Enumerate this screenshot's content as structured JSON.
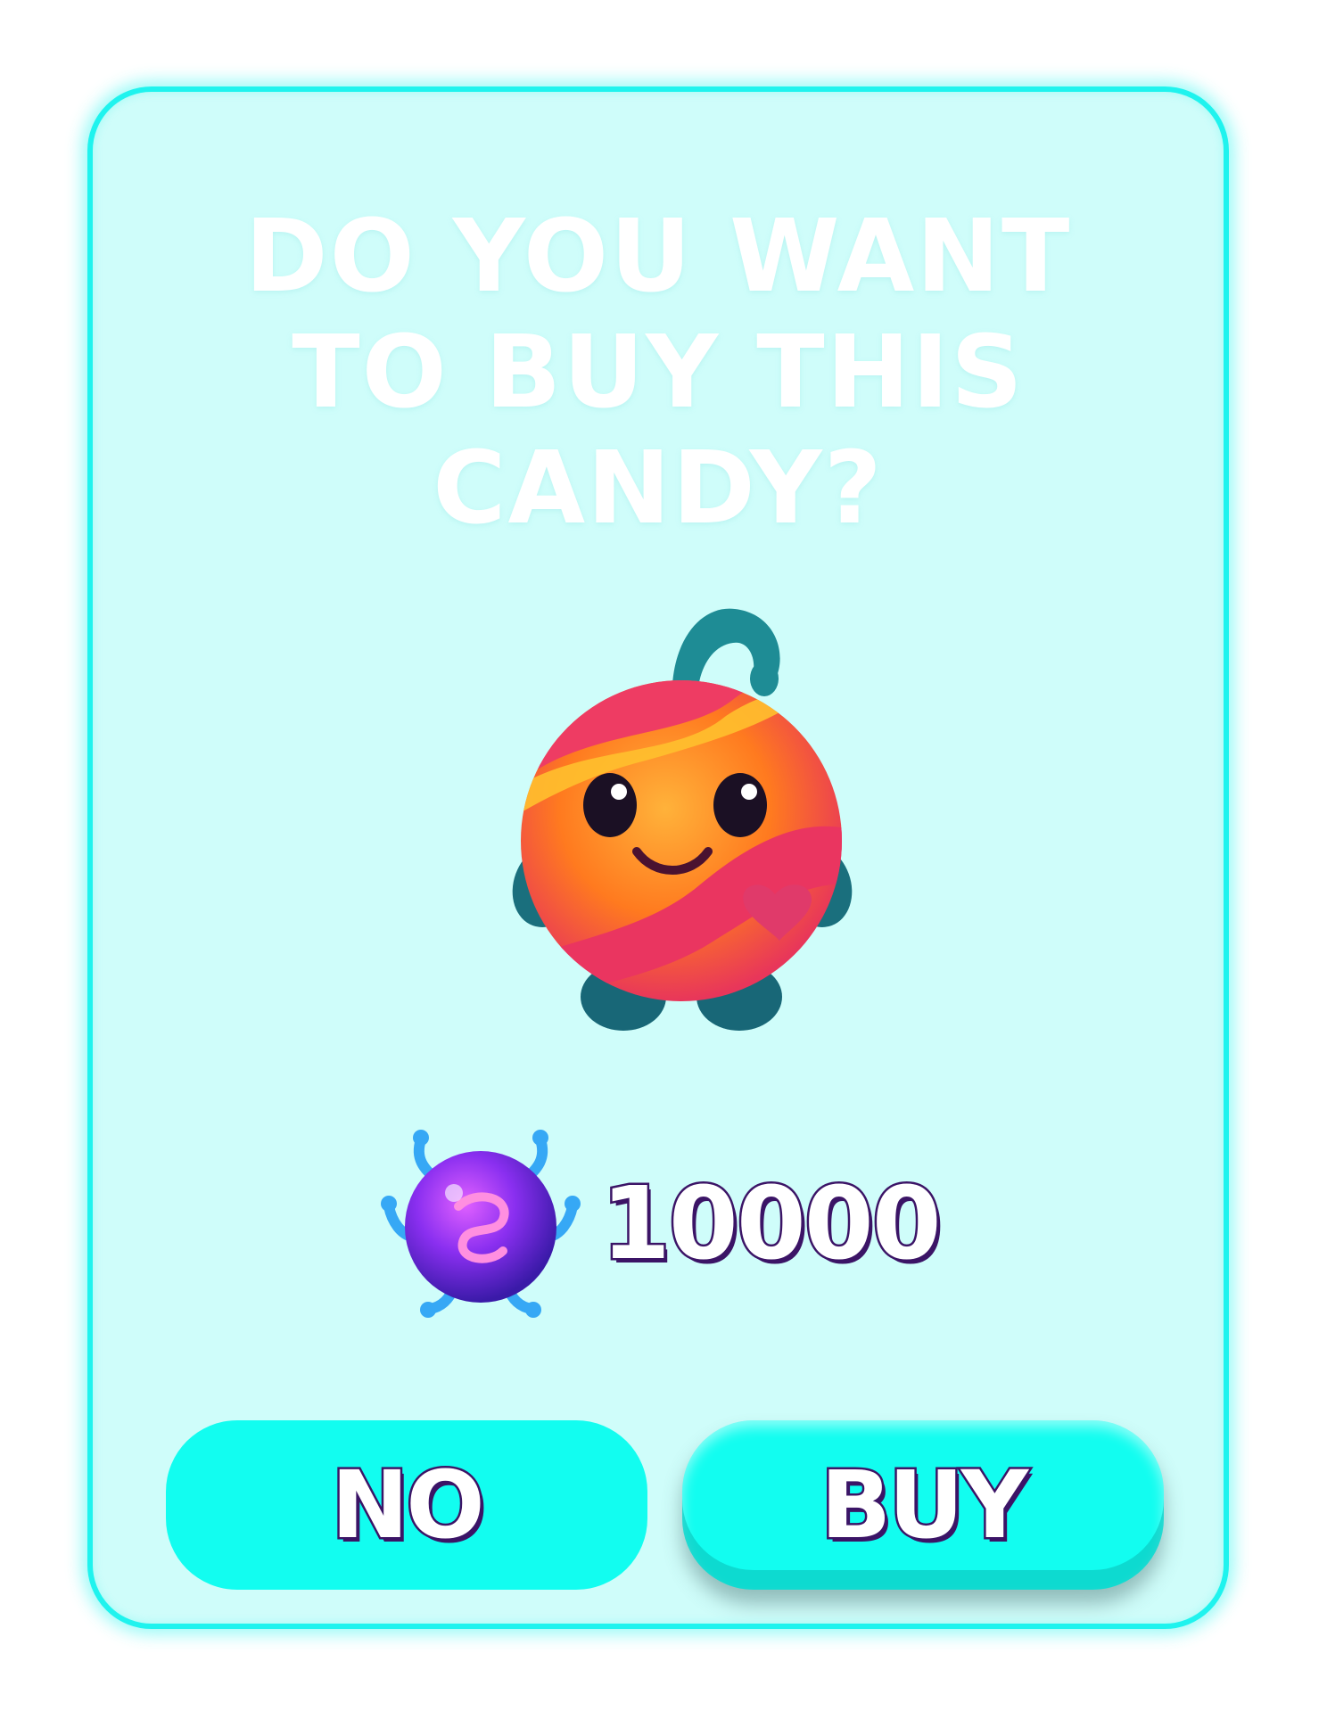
{
  "dialog": {
    "title_lines": [
      "DO YOU WANT",
      "TO BUY THIS",
      "CANDY?"
    ],
    "item": {
      "icon": "smiling-candy-creature"
    },
    "price": {
      "currency_icon": "purple-swirl-orb-currency",
      "amount": "10000"
    },
    "buttons": {
      "no_label": "NO",
      "buy_label": "BUY"
    }
  },
  "colors": {
    "frame": "#1ff3ee",
    "panel": "#cffdfa",
    "button": "#12fdf0",
    "text_outline": "#3b1466",
    "title_text": "#ffffff"
  }
}
